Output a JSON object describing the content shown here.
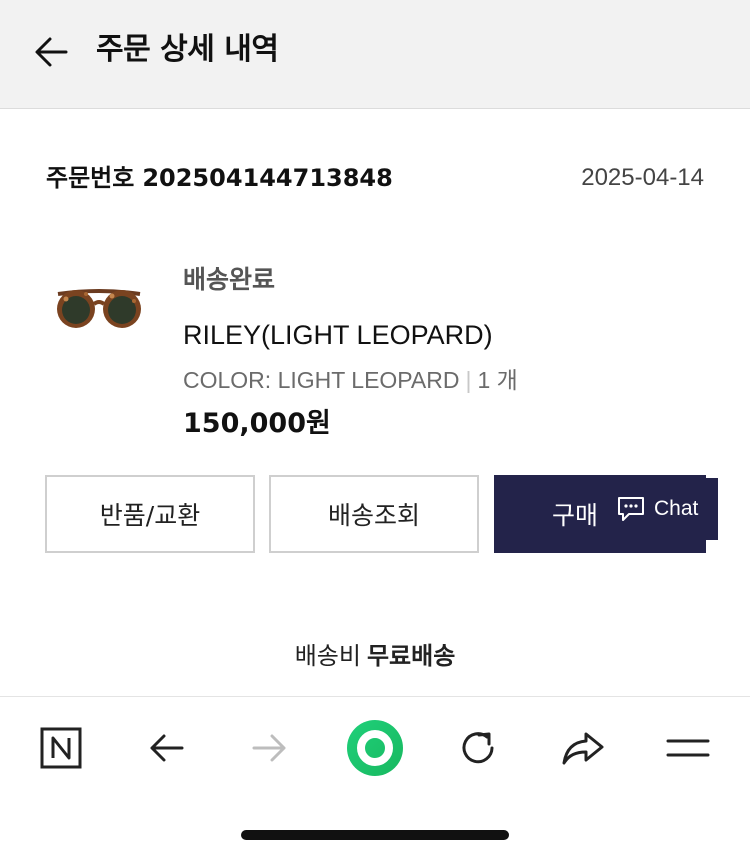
{
  "header": {
    "title": "주문 상세 내역",
    "back_icon": "arrow-left-icon"
  },
  "order": {
    "label": "주문번호",
    "number": "202504144713848",
    "date": "2025-04-14"
  },
  "product": {
    "status": "배송완료",
    "name": "RILEY(LIGHT LEOPARD)",
    "option": "COLOR: LIGHT LEOPARD",
    "quantity": "1 개",
    "price": "150,000원",
    "image": "sunglasses-thumbnail"
  },
  "buttons": {
    "return_exchange": "반품/교환",
    "tracking": "배송조회",
    "confirm": "구매"
  },
  "chat": {
    "label": "Chat",
    "icon": "chat-bubble-icon"
  },
  "shipping": {
    "label": "배송비",
    "value": "무료배송"
  },
  "toolbar": {
    "items": [
      "n-home-icon",
      "back-icon",
      "forward-icon",
      "green-dot-icon",
      "refresh-icon",
      "share-icon",
      "menu-icon"
    ],
    "accent": "#1ec767"
  },
  "colors": {
    "header_bg": "#f2f2f2",
    "confirm_bg": "#23234a"
  }
}
